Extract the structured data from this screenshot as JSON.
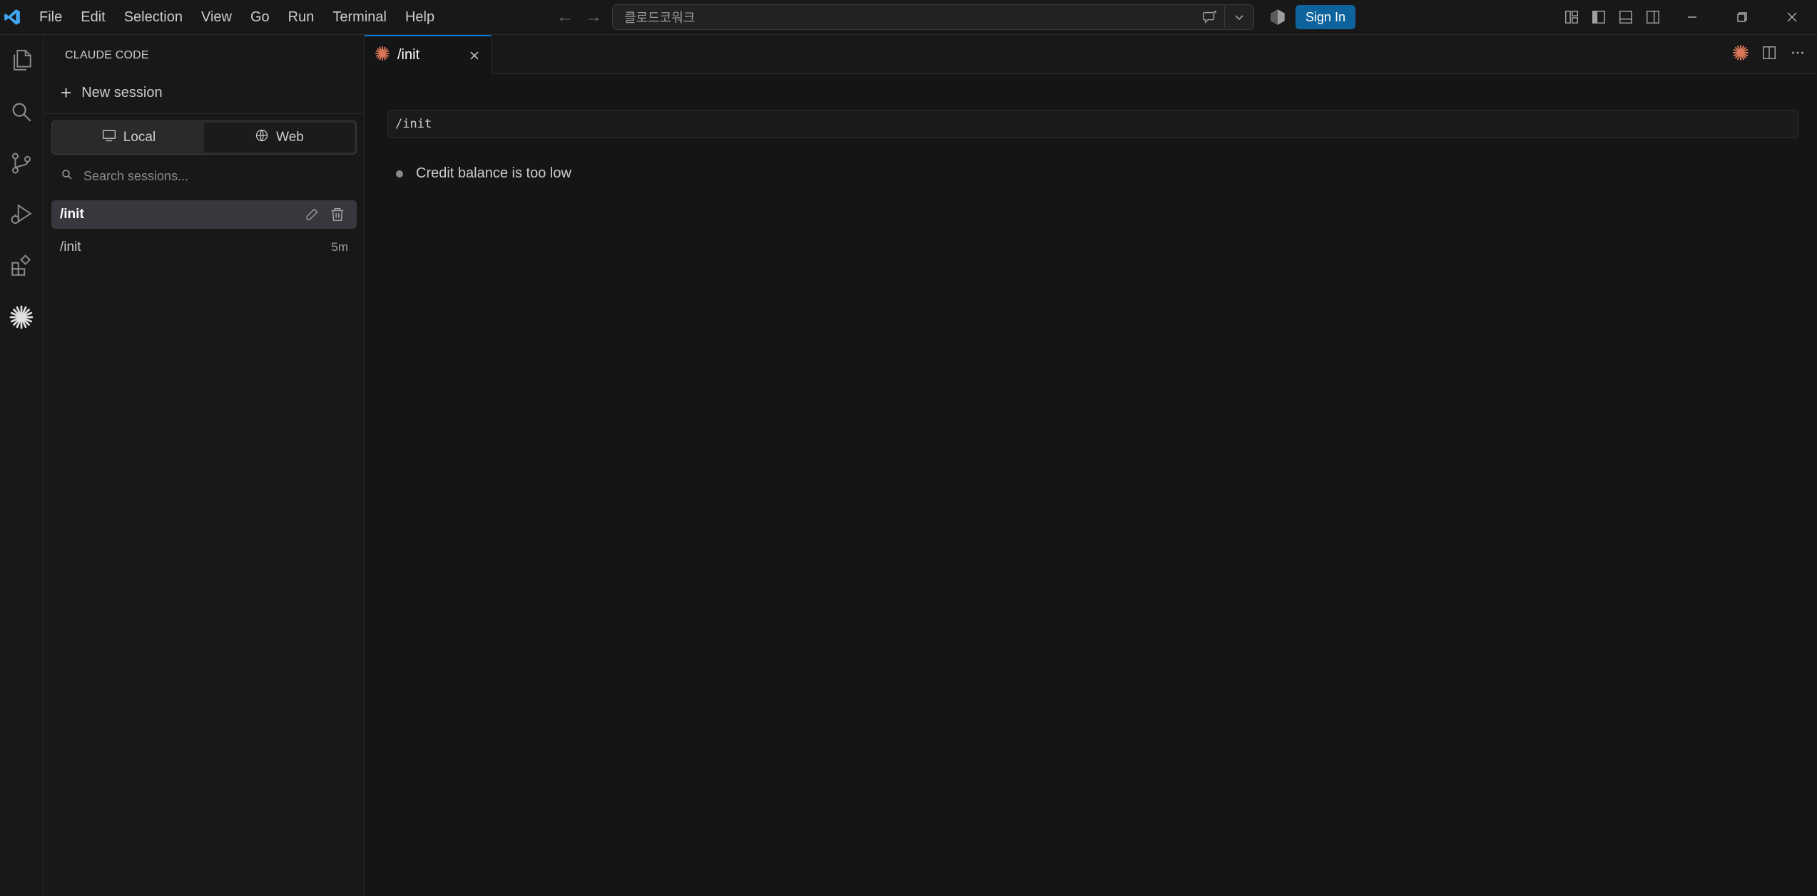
{
  "titlebar": {
    "menu": [
      "File",
      "Edit",
      "Selection",
      "View",
      "Go",
      "Run",
      "Terminal",
      "Help"
    ],
    "command_center_text": "클로드코워크",
    "signin_label": "Sign In"
  },
  "activitybar": {
    "items": [
      "files-icon",
      "search-icon",
      "source-control-icon",
      "run-debug-icon",
      "extensions-icon",
      "claude-icon"
    ]
  },
  "sidebar": {
    "title": "CLAUDE CODE",
    "new_session_label": "New session",
    "modes": {
      "local": "Local",
      "web": "Web",
      "active": "local"
    },
    "search_placeholder": "Search sessions...",
    "sessions": [
      {
        "label": "/init",
        "time": "",
        "selected": true
      },
      {
        "label": "/init",
        "time": "5m",
        "selected": false
      }
    ]
  },
  "editor": {
    "tab_label": "/init",
    "prompt_text": "/init",
    "message_text": "Credit balance is too low"
  },
  "colors": {
    "accent": "#0078d4",
    "signin_bg": "#0e639c",
    "claude_orange": "#d97757",
    "background": "#181818"
  }
}
